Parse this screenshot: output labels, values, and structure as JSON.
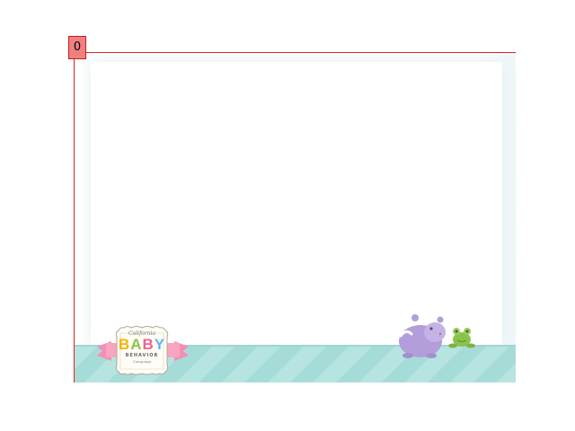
{
  "overlay": {
    "index_label": "0"
  },
  "logo": {
    "top_line": "California",
    "main_letters": [
      "B",
      "A",
      "B",
      "Y"
    ],
    "sub_line": "BEHAVIOR",
    "tag_line": "Campaign"
  },
  "colors": {
    "frame_border": "#e02020",
    "badge_fill": "#f08080",
    "ground": "#b5e4e1",
    "ribbon": "#f48fb1",
    "hippo": "#b39ddb",
    "frog": "#8bc34a"
  },
  "icons": {
    "hippo": "hippo-icon",
    "frog": "frog-icon"
  }
}
